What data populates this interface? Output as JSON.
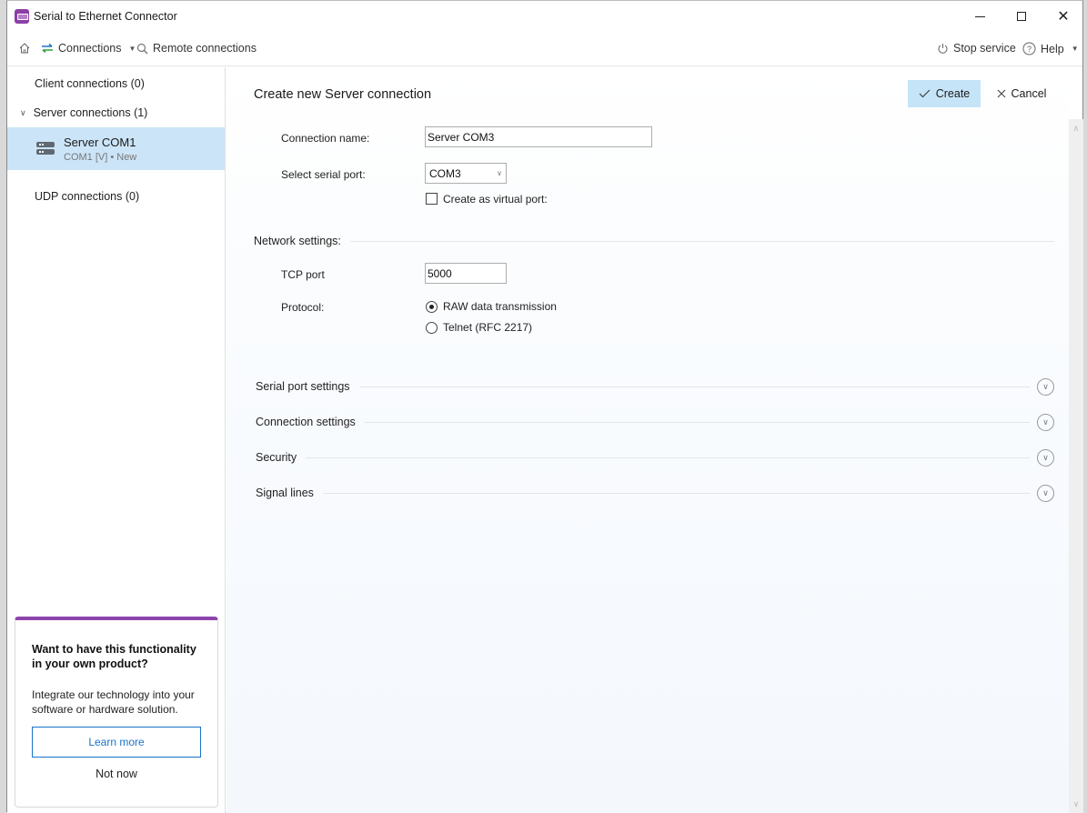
{
  "window": {
    "title": "Serial to Ethernet Connector",
    "controls": {
      "minimize": "minimize",
      "maximize": "maximize",
      "close": "close"
    }
  },
  "toolbar": {
    "home_icon": "home-icon",
    "connections_label": "Connections",
    "remote_label": "Remote connections",
    "stop_label": "Stop service",
    "help_label": "Help"
  },
  "sidebar": {
    "client": "Client connections (0)",
    "server": "Server connections (1)",
    "server_items": [
      {
        "name": "Server COM1",
        "sub": "COM1 [V] • New",
        "selected": true
      }
    ],
    "udp": "UDP connections (0)"
  },
  "promo": {
    "title": "Want to have this functionality in your own product?",
    "text": "Integrate our technology into your software or hardware solution.",
    "learn_more": "Learn more",
    "not_now": "Not now",
    "accent": "#8e44ad"
  },
  "main": {
    "title": "Create new Server connection",
    "create_label": "Create",
    "cancel_label": "Cancel",
    "connection_name_label": "Connection name:",
    "connection_name_value": "Server COM3",
    "serial_port_label": "Select serial port:",
    "serial_port_value": "COM3",
    "virtual_port_label": "Create as virtual port:",
    "virtual_port_checked": false,
    "network_section": "Network settings:",
    "tcp_port_label": "TCP port",
    "tcp_port_value": "5000",
    "protocol_label": "Protocol:",
    "protocol_options": [
      {
        "label": "RAW data transmission",
        "selected": true
      },
      {
        "label": "Telnet (RFC 2217)",
        "selected": false
      }
    ],
    "collapsibles": [
      "Serial port settings",
      "Connection settings",
      "Security",
      "Signal lines"
    ]
  },
  "colors": {
    "create_bg": "#c6e4f8",
    "selected_bg": "#cce4f7",
    "link": "#1a73c8"
  }
}
